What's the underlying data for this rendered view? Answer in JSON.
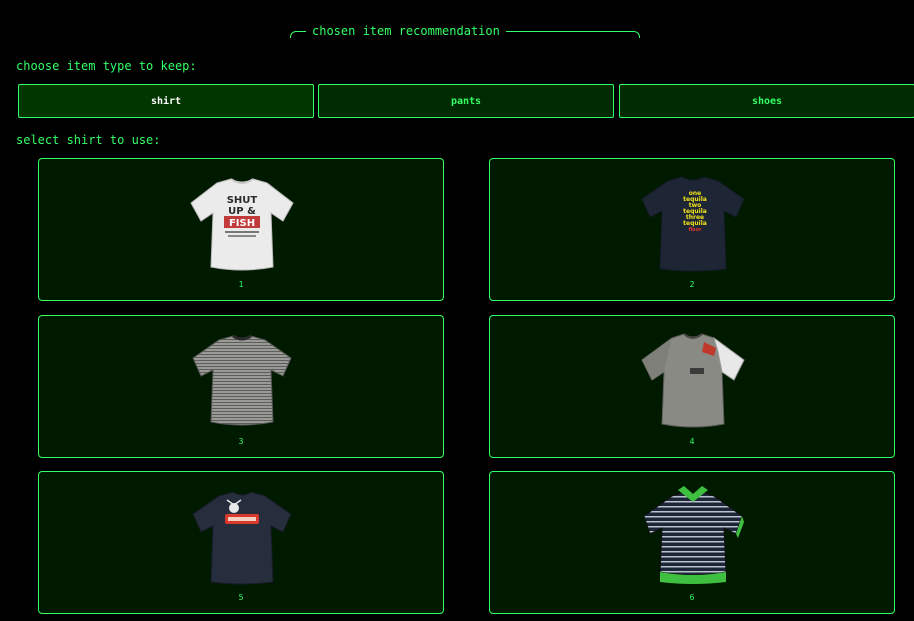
{
  "section": {
    "title": "chosen item recommendation"
  },
  "choose_label": "choose item type to keep:",
  "types": [
    {
      "label": "shirt",
      "active": true
    },
    {
      "label": "pants",
      "active": false
    },
    {
      "label": "shoes",
      "active": false
    }
  ],
  "select_label": "select shirt to use:",
  "items": [
    {
      "number": "1",
      "print_lines": [
        "SHUT",
        "UP &",
        "FISH"
      ],
      "color": "#e8e8e8"
    },
    {
      "number": "2",
      "print_lines": [
        "one",
        "tequila",
        "two",
        "tequila",
        "three",
        "tequila",
        "floor"
      ],
      "color": "#1e2535"
    },
    {
      "number": "3",
      "color": "#8c8c88"
    },
    {
      "number": "4",
      "color": "#8a8a84"
    },
    {
      "number": "5",
      "color": "#262d3c"
    },
    {
      "number": "6",
      "color": "#1c2636"
    }
  ],
  "colors": {
    "accent": "#33ff66",
    "background": "#000000",
    "button_bg": "#012b01",
    "card_bg": "#001a00"
  }
}
